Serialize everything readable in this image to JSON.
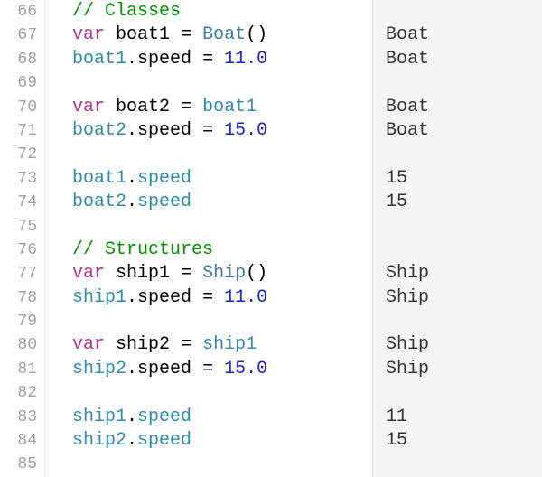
{
  "lines": {
    "start": 66,
    "rows": [
      {
        "tokens": [
          {
            "cls": "t-comment",
            "key": "c1"
          }
        ],
        "result": null
      },
      {
        "tokens": [
          {
            "cls": "t-keyword",
            "key": "k_var"
          },
          {
            "cls": "t-plain",
            "key": "sp"
          },
          {
            "cls": "t-plain",
            "key": "id_boat1"
          },
          {
            "cls": "t-plain",
            "key": "sp"
          },
          {
            "cls": "t-punct",
            "key": "eq"
          },
          {
            "cls": "t-plain",
            "key": "sp"
          },
          {
            "cls": "t-type",
            "key": "ty_Boat"
          },
          {
            "cls": "t-punct",
            "key": "paren"
          }
        ],
        "result": "r_Boat"
      },
      {
        "tokens": [
          {
            "cls": "t-ident",
            "key": "id_boat1"
          },
          {
            "cls": "t-punct",
            "key": "dot"
          },
          {
            "cls": "t-plain",
            "key": "p_speed"
          },
          {
            "cls": "t-plain",
            "key": "sp"
          },
          {
            "cls": "t-punct",
            "key": "eq"
          },
          {
            "cls": "t-plain",
            "key": "sp"
          },
          {
            "cls": "t-number",
            "key": "n_11_0"
          }
        ],
        "result": "r_Boat"
      },
      {
        "tokens": [],
        "result": null
      },
      {
        "tokens": [
          {
            "cls": "t-keyword",
            "key": "k_var"
          },
          {
            "cls": "t-plain",
            "key": "sp"
          },
          {
            "cls": "t-plain",
            "key": "id_boat2"
          },
          {
            "cls": "t-plain",
            "key": "sp"
          },
          {
            "cls": "t-punct",
            "key": "eq"
          },
          {
            "cls": "t-plain",
            "key": "sp"
          },
          {
            "cls": "t-ident",
            "key": "id_boat1"
          }
        ],
        "result": "r_Boat"
      },
      {
        "tokens": [
          {
            "cls": "t-ident",
            "key": "id_boat2"
          },
          {
            "cls": "t-punct",
            "key": "dot"
          },
          {
            "cls": "t-plain",
            "key": "p_speed"
          },
          {
            "cls": "t-plain",
            "key": "sp"
          },
          {
            "cls": "t-punct",
            "key": "eq"
          },
          {
            "cls": "t-plain",
            "key": "sp"
          },
          {
            "cls": "t-number",
            "key": "n_15_0"
          }
        ],
        "result": "r_Boat"
      },
      {
        "tokens": [],
        "result": null
      },
      {
        "tokens": [
          {
            "cls": "t-ident",
            "key": "id_boat1"
          },
          {
            "cls": "t-punct",
            "key": "dot"
          },
          {
            "cls": "t-prop",
            "key": "p_speed"
          }
        ],
        "result": "r_15"
      },
      {
        "tokens": [
          {
            "cls": "t-ident",
            "key": "id_boat2"
          },
          {
            "cls": "t-punct",
            "key": "dot"
          },
          {
            "cls": "t-prop",
            "key": "p_speed"
          }
        ],
        "result": "r_15"
      },
      {
        "tokens": [],
        "result": null
      },
      {
        "tokens": [
          {
            "cls": "t-comment",
            "key": "c2"
          }
        ],
        "result": null
      },
      {
        "tokens": [
          {
            "cls": "t-keyword",
            "key": "k_var"
          },
          {
            "cls": "t-plain",
            "key": "sp"
          },
          {
            "cls": "t-plain",
            "key": "id_ship1"
          },
          {
            "cls": "t-plain",
            "key": "sp"
          },
          {
            "cls": "t-punct",
            "key": "eq"
          },
          {
            "cls": "t-plain",
            "key": "sp"
          },
          {
            "cls": "t-type",
            "key": "ty_Ship"
          },
          {
            "cls": "t-punct",
            "key": "paren"
          }
        ],
        "result": "r_Ship"
      },
      {
        "tokens": [
          {
            "cls": "t-ident",
            "key": "id_ship1"
          },
          {
            "cls": "t-punct",
            "key": "dot"
          },
          {
            "cls": "t-plain",
            "key": "p_speed"
          },
          {
            "cls": "t-plain",
            "key": "sp"
          },
          {
            "cls": "t-punct",
            "key": "eq"
          },
          {
            "cls": "t-plain",
            "key": "sp"
          },
          {
            "cls": "t-number",
            "key": "n_11_0"
          }
        ],
        "result": "r_Ship"
      },
      {
        "tokens": [],
        "result": null
      },
      {
        "tokens": [
          {
            "cls": "t-keyword",
            "key": "k_var"
          },
          {
            "cls": "t-plain",
            "key": "sp"
          },
          {
            "cls": "t-plain",
            "key": "id_ship2"
          },
          {
            "cls": "t-plain",
            "key": "sp"
          },
          {
            "cls": "t-punct",
            "key": "eq"
          },
          {
            "cls": "t-plain",
            "key": "sp"
          },
          {
            "cls": "t-ident",
            "key": "id_ship1"
          }
        ],
        "result": "r_Ship"
      },
      {
        "tokens": [
          {
            "cls": "t-ident",
            "key": "id_ship2"
          },
          {
            "cls": "t-punct",
            "key": "dot"
          },
          {
            "cls": "t-plain",
            "key": "p_speed"
          },
          {
            "cls": "t-plain",
            "key": "sp"
          },
          {
            "cls": "t-punct",
            "key": "eq"
          },
          {
            "cls": "t-plain",
            "key": "sp"
          },
          {
            "cls": "t-number",
            "key": "n_15_0"
          }
        ],
        "result": "r_Ship"
      },
      {
        "tokens": [],
        "result": null
      },
      {
        "tokens": [
          {
            "cls": "t-ident",
            "key": "id_ship1"
          },
          {
            "cls": "t-punct",
            "key": "dot"
          },
          {
            "cls": "t-prop",
            "key": "p_speed"
          }
        ],
        "result": "r_11"
      },
      {
        "tokens": [
          {
            "cls": "t-ident",
            "key": "id_ship2"
          },
          {
            "cls": "t-punct",
            "key": "dot"
          },
          {
            "cls": "t-prop",
            "key": "p_speed"
          }
        ],
        "result": "r_15"
      },
      {
        "tokens": [],
        "result": null
      }
    ]
  },
  "strings": {
    "c1": "// Classes",
    "c2": "// Structures",
    "k_var": "var",
    "sp": " ",
    "eq": "=",
    "dot": ".",
    "paren": "()",
    "id_boat1": "boat1",
    "id_boat2": "boat2",
    "id_ship1": "ship1",
    "id_ship2": "ship2",
    "ty_Boat": "Boat",
    "ty_Ship": "Ship",
    "p_speed": "speed",
    "n_11_0": "11.0",
    "n_15_0": "15.0",
    "r_Boat": "Boat",
    "r_Ship": "Ship",
    "r_11": "11",
    "r_15": "15"
  }
}
